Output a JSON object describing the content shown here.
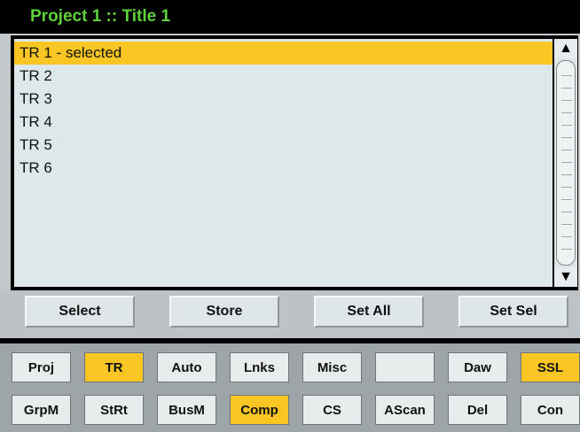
{
  "title": "Project 1 :: Title 1",
  "list": {
    "items": [
      {
        "label": "TR 1  -  selected",
        "selected": true
      },
      {
        "label": "TR  2",
        "selected": false
      },
      {
        "label": "TR  3",
        "selected": false
      },
      {
        "label": "TR  4",
        "selected": false
      },
      {
        "label": "TR  5",
        "selected": false
      },
      {
        "label": "TR  6",
        "selected": false
      }
    ]
  },
  "scrollbar": {
    "up_icon": "chevron-up-icon",
    "down_icon": "chevron-down-icon"
  },
  "actions": {
    "select": "Select",
    "store": "Store",
    "set_all": "Set All",
    "set_sel": "Set Sel"
  },
  "tabs_row1": [
    {
      "label": "Proj",
      "active": false
    },
    {
      "label": "TR",
      "active": true
    },
    {
      "label": "Auto",
      "active": false
    },
    {
      "label": "Lnks",
      "active": false
    },
    {
      "label": "Misc",
      "active": false
    },
    {
      "label": "",
      "active": false
    },
    {
      "label": "Daw",
      "active": false
    },
    {
      "label": "SSL",
      "active": true
    }
  ],
  "tabs_row2": [
    {
      "label": "GrpM",
      "active": false
    },
    {
      "label": "StRt",
      "active": false
    },
    {
      "label": "BusM",
      "active": false
    },
    {
      "label": "Comp",
      "active": true
    },
    {
      "label": "CS",
      "active": false
    },
    {
      "label": "AScan",
      "active": false
    },
    {
      "label": "Del",
      "active": false
    },
    {
      "label": "Con",
      "active": false
    }
  ],
  "colors": {
    "title_text": "#5fd13a",
    "selected": "#f9c623",
    "list_bg": "#dde8ea"
  }
}
